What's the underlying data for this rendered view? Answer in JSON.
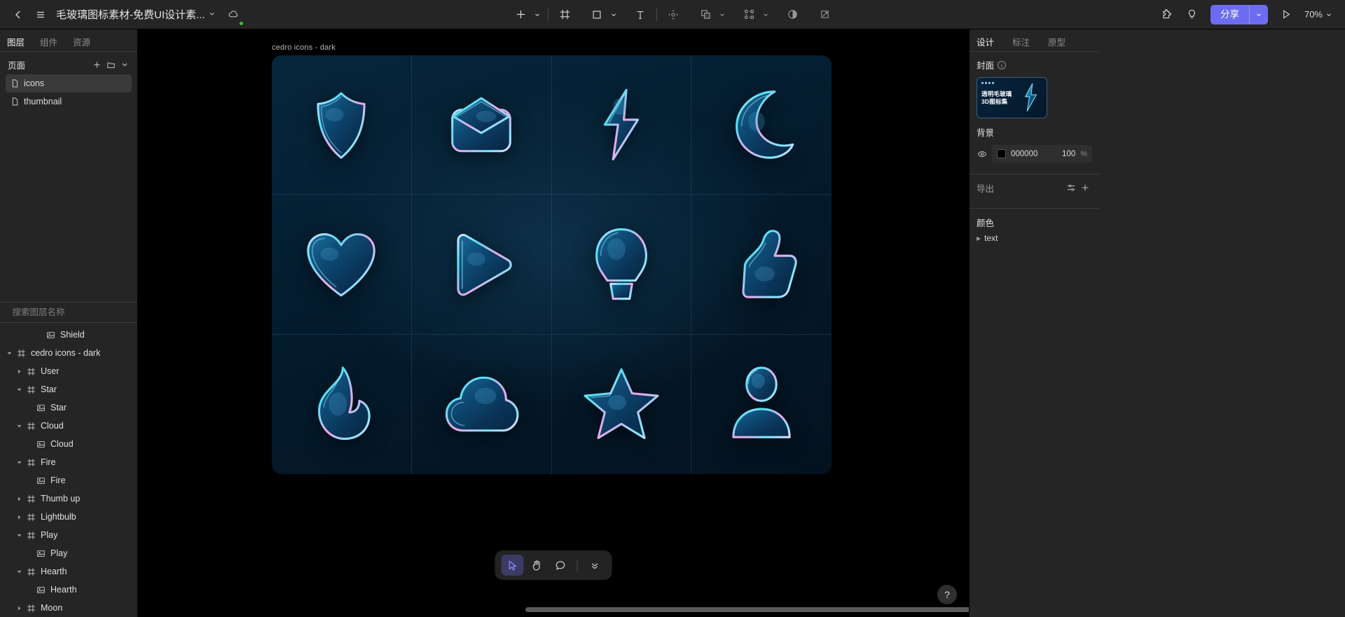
{
  "topbar": {
    "back_icon": "chevron-left-icon",
    "menu_icon": "hamburger-menu-icon",
    "doc_title": "毛玻璃图标素材-免费UI设计素...",
    "title_caret": "chevron-down-icon",
    "cloud_icon": "cloud-sync-icon",
    "tools": [
      {
        "name": "add-tool",
        "icon": "plus-icon",
        "has_caret": true
      },
      {
        "name": "frame-tool",
        "icon": "frame-icon",
        "has_caret": false
      },
      {
        "name": "shape-tool",
        "icon": "square-icon",
        "has_caret": true
      },
      {
        "name": "text-tool",
        "icon": "text-t-icon",
        "has_caret": false
      },
      {
        "name": "transform-tool",
        "icon": "move-anchor-icon",
        "has_caret": false
      },
      {
        "name": "boolean-tool",
        "icon": "boolean-union-icon",
        "has_caret": true
      },
      {
        "name": "mask-tool",
        "icon": "vector-points-icon",
        "has_caret": true
      },
      {
        "name": "contrast-tool",
        "icon": "contrast-circle-icon",
        "has_caret": false
      },
      {
        "name": "slice-tool",
        "icon": "crop-slice-icon",
        "has_caret": false
      }
    ],
    "plugin_icon": "puzzle-plugin-icon",
    "idea_icon": "lightbulb-idea-icon",
    "share_label": "分享",
    "share_caret": "chevron-down-icon",
    "share_color": "#6c6cf0",
    "present_icon": "play-present-icon",
    "zoom_level": "70%",
    "zoom_caret": "chevron-down-icon"
  },
  "left_panel": {
    "tabs": [
      {
        "label": "图层",
        "active": true
      },
      {
        "label": "组件",
        "active": false
      },
      {
        "label": "资源",
        "active": false
      }
    ],
    "pages_header": {
      "title": "页面",
      "add_icon": "plus-icon",
      "folder_icon": "folder-icon",
      "collapse_icon": "chevron-down-icon"
    },
    "pages": [
      {
        "label": "icons",
        "icon": "page-file-icon",
        "selected": true
      },
      {
        "label": "thumbnail",
        "icon": "page-file-icon",
        "selected": false
      }
    ],
    "search": {
      "placeholder": "搜索图层名称",
      "icon": "search-icon",
      "filter_icon": "sort-filter-icon"
    },
    "layers": [
      {
        "label": "Shield",
        "icon": "image-layer-icon",
        "depth": 3,
        "caret": "none"
      },
      {
        "label": "cedro icons - dark",
        "icon": "frame-layer-icon",
        "depth": 0,
        "caret": "down"
      },
      {
        "label": "User",
        "icon": "frame-layer-icon",
        "depth": 1,
        "caret": "right"
      },
      {
        "label": "Star",
        "icon": "frame-layer-icon",
        "depth": 1,
        "caret": "down"
      },
      {
        "label": "Star",
        "icon": "image-layer-icon",
        "depth": 2,
        "caret": "none"
      },
      {
        "label": "Cloud",
        "icon": "frame-layer-icon",
        "depth": 1,
        "caret": "down"
      },
      {
        "label": "Cloud",
        "icon": "image-layer-icon",
        "depth": 2,
        "caret": "none"
      },
      {
        "label": "Fire",
        "icon": "frame-layer-icon",
        "depth": 1,
        "caret": "down"
      },
      {
        "label": "Fire",
        "icon": "image-layer-icon",
        "depth": 2,
        "caret": "none"
      },
      {
        "label": "Thumb up",
        "icon": "frame-layer-icon",
        "depth": 1,
        "caret": "right"
      },
      {
        "label": "Lightbulb",
        "icon": "frame-layer-icon",
        "depth": 1,
        "caret": "right"
      },
      {
        "label": "Play",
        "icon": "frame-layer-icon",
        "depth": 1,
        "caret": "down"
      },
      {
        "label": "Play",
        "icon": "image-layer-icon",
        "depth": 2,
        "caret": "none"
      },
      {
        "label": "Hearth",
        "icon": "frame-layer-icon",
        "depth": 1,
        "caret": "down"
      },
      {
        "label": "Hearth",
        "icon": "image-layer-icon",
        "depth": 2,
        "caret": "none"
      },
      {
        "label": "Moon",
        "icon": "frame-layer-icon",
        "depth": 1,
        "caret": "right"
      }
    ]
  },
  "canvas": {
    "frame_label": "cedro icons - dark",
    "background": "#000000",
    "artboard_bg": "#05243c",
    "icons": [
      {
        "name": "shield-glass-icon",
        "shape": "shield"
      },
      {
        "name": "mail-glass-icon",
        "shape": "mail"
      },
      {
        "name": "bolt-glass-icon",
        "shape": "bolt"
      },
      {
        "name": "moon-glass-icon",
        "shape": "moon"
      },
      {
        "name": "heart-glass-icon",
        "shape": "heart"
      },
      {
        "name": "play-glass-icon",
        "shape": "play"
      },
      {
        "name": "lightbulb-glass-icon",
        "shape": "bulb"
      },
      {
        "name": "thumbup-glass-icon",
        "shape": "thumb"
      },
      {
        "name": "fire-glass-icon",
        "shape": "fire"
      },
      {
        "name": "cloud-glass-icon",
        "shape": "cloud"
      },
      {
        "name": "star-glass-icon",
        "shape": "star"
      },
      {
        "name": "user-glass-icon",
        "shape": "user"
      }
    ],
    "bottom_toolbar": [
      {
        "name": "select-tool",
        "icon": "cursor-arrow-icon",
        "active": true
      },
      {
        "name": "hand-tool",
        "icon": "hand-icon",
        "active": false
      },
      {
        "name": "comment-tool",
        "icon": "comment-icon",
        "active": false
      },
      {
        "name": "more-tools",
        "icon": "chevrons-down-icon",
        "active": false
      }
    ],
    "help_label": "?"
  },
  "right_panel": {
    "tabs": [
      {
        "label": "设计",
        "active": true
      },
      {
        "label": "标注",
        "active": false
      },
      {
        "label": "原型",
        "active": false
      }
    ],
    "cover": {
      "title": "封面",
      "info_icon": "info-circle-icon",
      "thumb_line1": "透明毛玻璃",
      "thumb_line2": "3D图标集"
    },
    "background": {
      "title": "背景",
      "visibility_icon": "eye-icon",
      "hex": "000000",
      "swatch": "#000000",
      "opacity": "100",
      "unit": "%"
    },
    "export": {
      "title": "导出",
      "settings_icon": "sliders-icon",
      "add_icon": "plus-icon"
    },
    "colors": {
      "title": "颜色",
      "items": [
        {
          "label": "text",
          "caret": "right"
        }
      ]
    }
  }
}
